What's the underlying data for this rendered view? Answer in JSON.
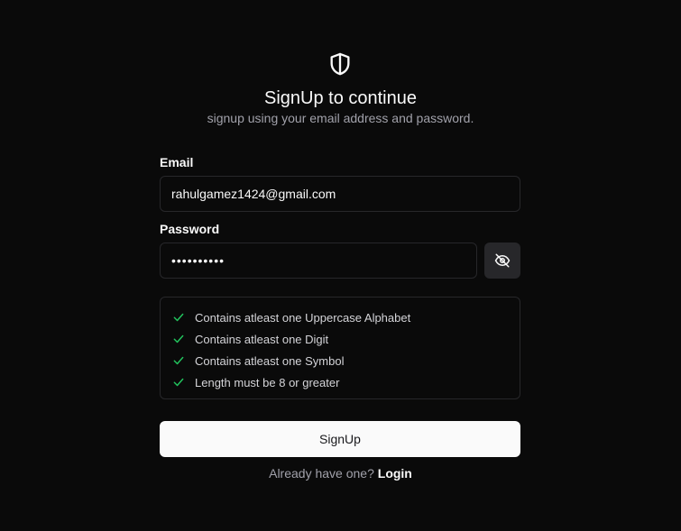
{
  "header": {
    "icon": "shield-icon",
    "title": "SignUp to continue",
    "subtitle": "signup using your email address and password."
  },
  "form": {
    "email": {
      "label": "Email",
      "value": "rahulgamez1424@gmail.com"
    },
    "password": {
      "label": "Password",
      "value": "••••••••••",
      "toggle_icon": "eye-off-icon"
    },
    "requirements": [
      {
        "text": "Contains atleast one Uppercase Alphabet",
        "met": true
      },
      {
        "text": "Contains atleast one Digit",
        "met": true
      },
      {
        "text": "Contains atleast one Symbol",
        "met": true
      },
      {
        "text": "Length must be 8 or greater",
        "met": true
      }
    ],
    "submit_label": "SignUp"
  },
  "footer": {
    "prompt": "Already have one?",
    "link_label": "Login"
  },
  "colors": {
    "background": "#0a0a0a",
    "check": "#22c55e",
    "border": "#27272a"
  }
}
